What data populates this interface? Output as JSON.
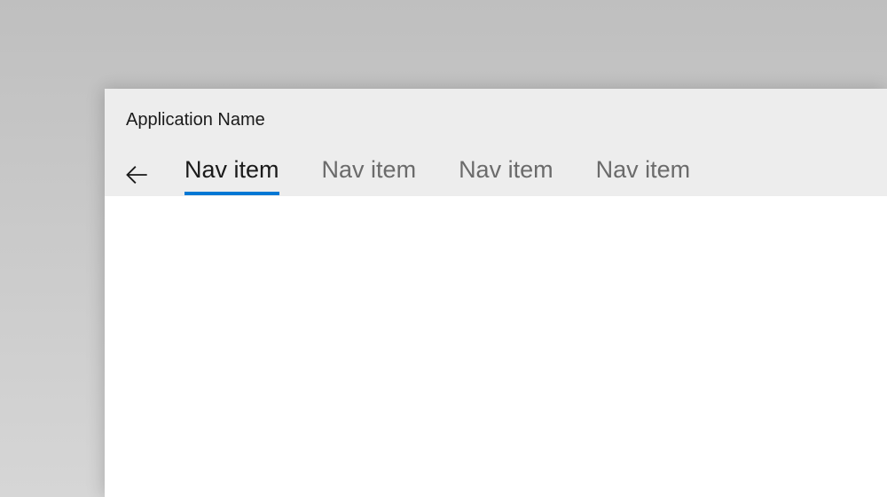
{
  "header": {
    "app_title": "Application Name"
  },
  "nav": {
    "items": [
      {
        "label": "Nav item",
        "active": true
      },
      {
        "label": "Nav item",
        "active": false
      },
      {
        "label": "Nav item",
        "active": false
      },
      {
        "label": "Nav item",
        "active": false
      }
    ]
  },
  "colors": {
    "accent": "#0078d4",
    "header_bg": "#ededed",
    "content_bg": "#ffffff",
    "text_primary": "#1a1a1a",
    "text_secondary": "#6b6b6b"
  }
}
